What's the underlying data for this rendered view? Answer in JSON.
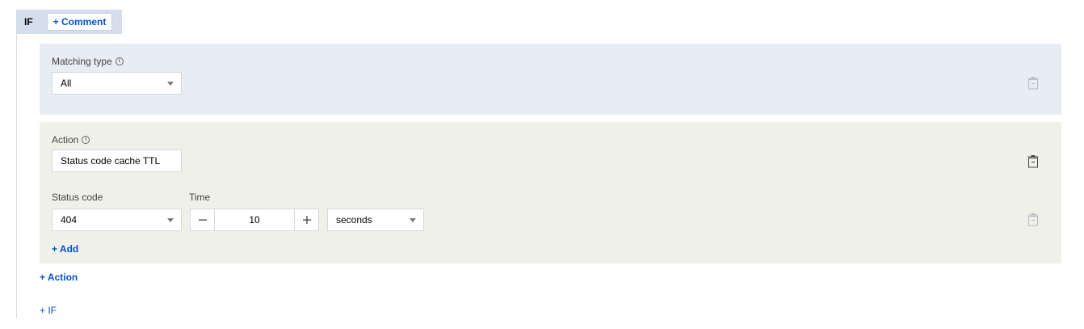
{
  "if_block": {
    "if_label": "IF",
    "comment_label": "+ Comment"
  },
  "matching": {
    "label": "Matching type",
    "info_icon": "info-circle-icon",
    "value": "All"
  },
  "action": {
    "label": "Action",
    "info_icon": "info-circle-icon",
    "value": "Status code cache TTL",
    "status_code_label": "Status code",
    "time_label": "Time",
    "status_code_value": "404",
    "time_value": "10",
    "time_unit": "seconds",
    "add_label": "+ Add"
  },
  "footer": {
    "add_action_label": "+ Action",
    "add_if_label": "+ IF"
  },
  "colors": {
    "accent": "#0052d9",
    "matching_bg": "#e8edf5",
    "action_bg": "#eff1e9",
    "if_tag_bg": "#d5deec"
  }
}
